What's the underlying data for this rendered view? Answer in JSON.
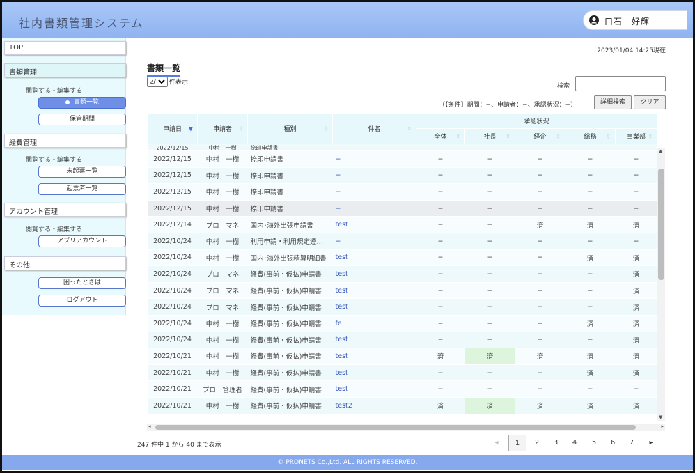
{
  "header": {
    "title": "社内書類管理システム",
    "user": "口石　好輝"
  },
  "timestamp": "2023/01/04 14:25現在",
  "sidebar": {
    "top": "TOP",
    "doc_mgmt": "書類管理",
    "doc_sub": "閲覧する・編集する",
    "doc_list": "書類一覧",
    "storage": "保管期間",
    "expense_mgmt": "経費管理",
    "expense_sub": "閲覧する・編集する",
    "unsettled": "未起票一覧",
    "settled": "起票済一覧",
    "account_mgmt": "アカウント管理",
    "account_sub": "閲覧する・編集する",
    "app_account": "アプリアカウント",
    "other": "その他",
    "help": "困ったときは",
    "logout": "ログアウト"
  },
  "main": {
    "title": "書類一覧",
    "per_page_value": "40",
    "per_page_suffix": "件表示",
    "search_label": "検索",
    "conditions": "（【条件】期間：−、申請者：−、承認状況：−）",
    "detail_button": "詳細検索",
    "clear_button": "クリア"
  },
  "table": {
    "headers": {
      "date": "申請日",
      "applicant": "申請者",
      "type": "種別",
      "subject": "件名",
      "approval": "承認状況"
    },
    "approval_headers": [
      "全体",
      "社長",
      "経企",
      "総務",
      "事業部"
    ],
    "cut_row": [
      "2022/12/15",
      "中村　一樹",
      "捺印申請書",
      "−",
      "−",
      "−",
      "−",
      "−",
      "−"
    ],
    "rows": [
      [
        "2022/12/15",
        "中村　一樹",
        "捺印申請書",
        "−",
        "−",
        "−",
        "−",
        "−",
        "−"
      ],
      [
        "2022/12/15",
        "中村　一樹",
        "捺印申請書",
        "−",
        "−",
        "−",
        "−",
        "−",
        "−"
      ],
      [
        "2022/12/15",
        "中村　一樹",
        "捺印申請書",
        "−",
        "−",
        "−",
        "−",
        "−",
        "−"
      ],
      [
        "2022/12/15",
        "中村　一樹",
        "捺印申請書",
        "−",
        "−",
        "−",
        "−",
        "−",
        "−"
      ],
      [
        "2022/12/14",
        "プロ　マネ",
        "国内･海外出張申請書",
        "test",
        "−",
        "−",
        "済",
        "済",
        "済"
      ],
      [
        "2022/10/24",
        "中村　一樹",
        "利用申請・利用規定遵…",
        "−",
        "−",
        "−",
        "−",
        "−",
        "−"
      ],
      [
        "2022/10/24",
        "中村　一樹",
        "国内･海外出張精算明細書",
        "test",
        "−",
        "−",
        "−",
        "済",
        "済"
      ],
      [
        "2022/10/24",
        "プロ　マネ",
        "経費(事前・仮払)申請書",
        "test",
        "−",
        "−",
        "−",
        "−",
        "済"
      ],
      [
        "2022/10/24",
        "プロ　マネ",
        "経費(事前・仮払)申請書",
        "test",
        "−",
        "−",
        "−",
        "−",
        "済"
      ],
      [
        "2022/10/24",
        "プロ　マネ",
        "経費(事前・仮払)申請書",
        "test",
        "−",
        "−",
        "−",
        "−",
        "済"
      ],
      [
        "2022/10/24",
        "中村　一樹",
        "経費(事前・仮払)申請書",
        "fe",
        "−",
        "−",
        "−",
        "済",
        "済"
      ],
      [
        "2022/10/24",
        "中村　一樹",
        "経費(事前・仮払)申請書",
        "test",
        "−",
        "−",
        "−",
        "−",
        "済"
      ],
      [
        "2022/10/21",
        "中村　一樹",
        "経費(事前・仮払)申請書",
        "test",
        "済",
        "済",
        "済",
        "済",
        "済"
      ],
      [
        "2022/10/21",
        "中村　一樹",
        "経費(事前・仮払)申請書",
        "test",
        "−",
        "−",
        "−",
        "済",
        "済"
      ],
      [
        "2022/10/21",
        "プロ　管理者",
        "経費(事前・仮払)申請書",
        "test",
        "−",
        "−",
        "−",
        "−",
        "−"
      ],
      [
        "2022/10/21",
        "中村　一樹",
        "経費(事前・仮払)申請書",
        "test2",
        "済",
        "済",
        "済",
        "済",
        "済"
      ]
    ]
  },
  "pagination": {
    "summary": "247 件中 1 から 40 まで表示",
    "prev": "◂",
    "pages": [
      "1",
      "2",
      "3",
      "4",
      "5",
      "6",
      "7"
    ],
    "next": "▸",
    "current": "1"
  },
  "footer": "© PRONETS Co.,Ltd. ALL RIGHTS RESERVED.",
  "colors": {
    "header": "#8fb3f1",
    "sidebar": "#e8fafd",
    "accent": "#6f8fe6",
    "approved_green": "#dcf5dc"
  }
}
